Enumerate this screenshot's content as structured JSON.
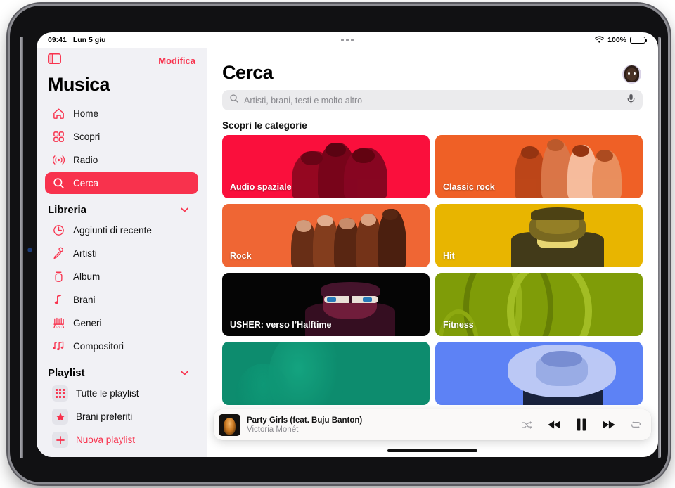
{
  "statusbar": {
    "time": "09:41",
    "date": "Lun 5 giu",
    "wifi_icon": "wifi-icon",
    "battery_percent": "100%",
    "battery_icon": "battery-full-icon",
    "grabber_icon": "window-grabber-dots-icon"
  },
  "sidebar": {
    "toggle_icon": "sidebar-toggle-icon",
    "edit_label": "Modifica",
    "app_title": "Musica",
    "nav": [
      {
        "label": "Home",
        "icon": "house-icon",
        "selected": false
      },
      {
        "label": "Scopri",
        "icon": "grid-squares-icon",
        "selected": false
      },
      {
        "label": "Radio",
        "icon": "radio-waves-icon",
        "selected": false
      },
      {
        "label": "Cerca",
        "icon": "search-icon",
        "selected": true
      }
    ],
    "library": {
      "title": "Libreria",
      "chevron_icon": "chevron-down-icon",
      "items": [
        {
          "label": "Aggiunti di recente",
          "icon": "clock-icon"
        },
        {
          "label": "Artisti",
          "icon": "microphone-icon"
        },
        {
          "label": "Album",
          "icon": "album-icon"
        },
        {
          "label": "Brani",
          "icon": "music-note-icon"
        },
        {
          "label": "Generi",
          "icon": "genres-icon"
        },
        {
          "label": "Compositori",
          "icon": "double-note-icon"
        }
      ]
    },
    "playlist": {
      "title": "Playlist",
      "chevron_icon": "chevron-down-icon",
      "items": [
        {
          "label": "Tutte le playlist",
          "icon": "playlist-grid-icon",
          "accent": false
        },
        {
          "label": "Brani preferiti",
          "icon": "star-icon",
          "accent": false
        },
        {
          "label": "Nuova playlist",
          "icon": "plus-icon",
          "accent": true
        }
      ]
    }
  },
  "main": {
    "page_title": "Cerca",
    "avatar_icon": "user-avatar",
    "search": {
      "placeholder": "Artisti, brani, testi e molto altro",
      "search_icon": "search-icon",
      "mic_icon": "microphone-icon"
    },
    "section_title": "Scopri le categorie",
    "cards": [
      {
        "label": "Audio spaziale",
        "bg": "#fa0f3c",
        "art": "group-of-three-men"
      },
      {
        "label": "Classic rock",
        "bg": "#ef6026",
        "art": "band-of-four"
      },
      {
        "label": "Rock",
        "bg": "#ef6634",
        "art": "band-of-five"
      },
      {
        "label": "Hit",
        "bg": "#e8b500",
        "art": "male-artist-portrait"
      },
      {
        "label": "USHER: verso l’Halftime",
        "bg": "#050505",
        "art": "artist-with-sunglasses"
      },
      {
        "label": "Fitness",
        "bg": "#7f9c08",
        "art": "gym-weights-abstract"
      },
      {
        "label": "",
        "bg": "#0d8c6e",
        "art": "green-abstract-gradient"
      },
      {
        "label": "",
        "bg": "#5d82f5",
        "art": "female-artist-portrait"
      }
    ]
  },
  "player": {
    "art_icon": "album-artwork",
    "title": "Party Girls (feat. Buju Banton)",
    "artist": "Victoria Monét",
    "controls": [
      {
        "name": "shuffle",
        "icon": "shuffle-icon",
        "active": false
      },
      {
        "name": "previous",
        "icon": "rewind-icon",
        "active": true
      },
      {
        "name": "pause",
        "icon": "pause-icon",
        "active": true
      },
      {
        "name": "next",
        "icon": "fast-forward-icon",
        "active": true
      },
      {
        "name": "repeat",
        "icon": "repeat-icon",
        "active": false
      }
    ]
  },
  "colors": {
    "accent": "#f8324d",
    "sidebar_bg": "#f1f1f5",
    "main_bg": "#ffffff"
  }
}
